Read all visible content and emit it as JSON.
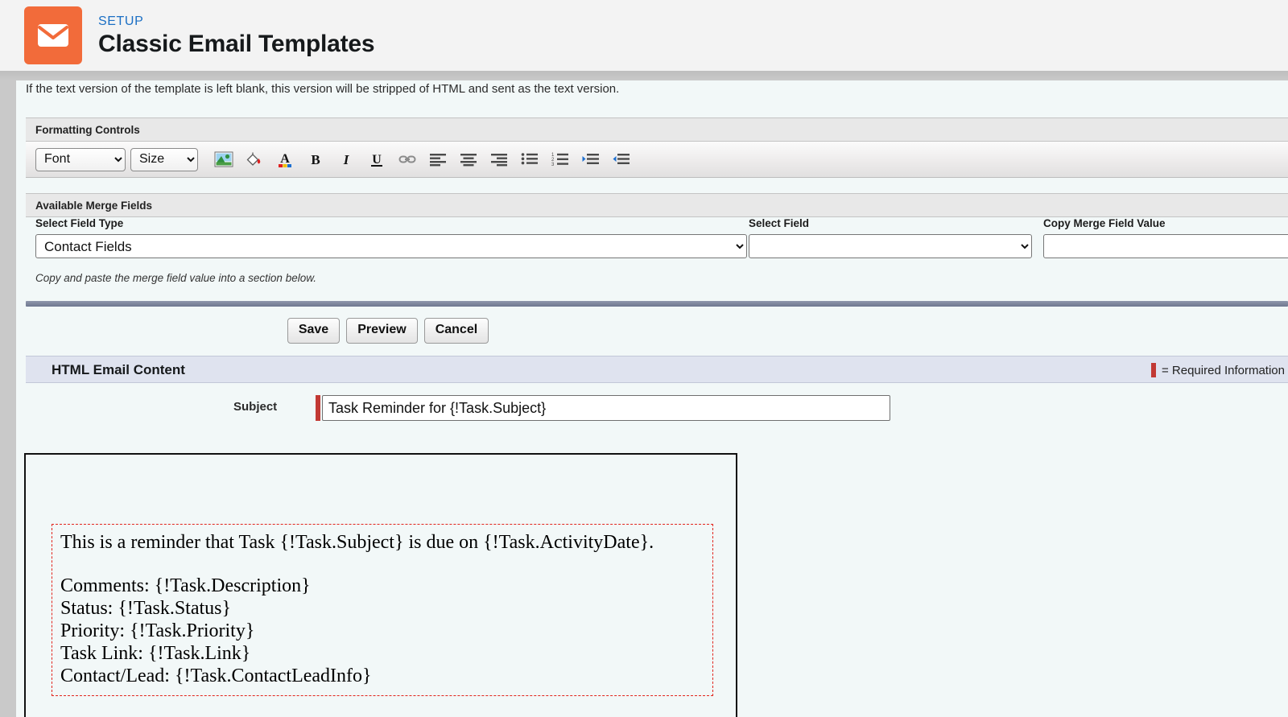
{
  "header": {
    "eyebrow": "SETUP",
    "title": "Classic Email Templates",
    "icon": "envelope-icon",
    "icon_bg": "#f26b3a",
    "eyebrow_color": "#1b6fc4"
  },
  "clipped_note": "If the text version of the template is left blank, this version will be stripped of HTML and sent as the text version.",
  "formatting": {
    "panel_title": "Formatting Controls",
    "font_select": {
      "value": "Font",
      "options": [
        "Font"
      ]
    },
    "size_select": {
      "value": "Size",
      "options": [
        "Size"
      ]
    },
    "tools": [
      {
        "name": "insert-image-icon",
        "label": "Insert Image"
      },
      {
        "name": "background-color-icon",
        "label": "Background Color"
      },
      {
        "name": "font-color-icon",
        "label": "Font Color"
      },
      {
        "name": "bold-icon",
        "label": "Bold"
      },
      {
        "name": "italic-icon",
        "label": "Italic"
      },
      {
        "name": "underline-icon",
        "label": "Underline"
      },
      {
        "name": "insert-link-icon",
        "label": "Insert Link"
      },
      {
        "name": "align-left-icon",
        "label": "Align Left"
      },
      {
        "name": "align-center-icon",
        "label": "Align Center"
      },
      {
        "name": "align-right-icon",
        "label": "Align Right"
      },
      {
        "name": "bulleted-list-icon",
        "label": "Bulleted List"
      },
      {
        "name": "numbered-list-icon",
        "label": "Numbered List"
      },
      {
        "name": "indent-icon",
        "label": "Indent"
      },
      {
        "name": "outdent-icon",
        "label": "Outdent"
      }
    ]
  },
  "merge_fields": {
    "panel_title": "Available Merge Fields",
    "field_type_label": "Select Field Type",
    "field_type_value": "Contact Fields",
    "field_type_options": [
      "Contact Fields"
    ],
    "select_field_label": "Select Field",
    "select_field_value": "",
    "copy_value_label": "Copy Merge Field Value",
    "copy_value_text": "",
    "hint": "Copy and paste the merge field value into a section below."
  },
  "actions": {
    "save_label": "Save",
    "preview_label": "Preview",
    "cancel_label": "Cancel"
  },
  "html_email_content": {
    "section_title": "HTML Email Content",
    "required_legend": "= Required Information",
    "required_color": "#c23934",
    "subject_label": "Subject",
    "subject_value": "Task Reminder for {!Task.Subject}",
    "body_lines": [
      "This is a reminder that Task {!Task.Subject} is due on {!Task.ActivityDate}.",
      "",
      "Comments: {!Task.Description}",
      "Status: {!Task.Status}",
      "Priority: {!Task.Priority}",
      "Task Link: {!Task.Link}",
      "Contact/Lead: {!Task.ContactLeadInfo}"
    ]
  }
}
